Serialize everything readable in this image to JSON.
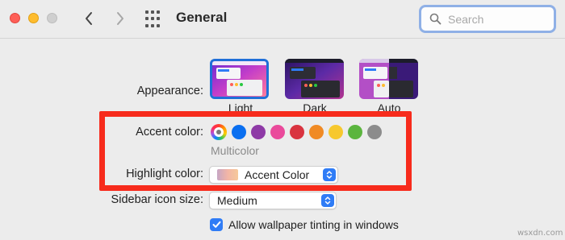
{
  "toolbar": {
    "title": "General",
    "search_placeholder": "Search"
  },
  "appearance": {
    "label": "Appearance:",
    "options": [
      {
        "label": "Light",
        "selected": true
      },
      {
        "label": "Dark",
        "selected": false
      },
      {
        "label": "Auto",
        "selected": false
      }
    ]
  },
  "accent": {
    "label": "Accent color:",
    "selected_name": "Multicolor",
    "colors": [
      "#0a6ff0",
      "#8e3aa6",
      "#ea4a9b",
      "#d9333f",
      "#f08a24",
      "#f7c82e",
      "#5bb53e",
      "#8c8c8c"
    ]
  },
  "highlight": {
    "label": "Highlight color:",
    "value": "Accent Color"
  },
  "sidebar_icon_size": {
    "label": "Sidebar icon size:",
    "value": "Medium"
  },
  "wallpaper_tinting": {
    "label": "Allow wallpaper tinting in windows",
    "checked": true
  },
  "watermark": "wsxdn.com",
  "colors": {
    "accent_blue": "#2f7cf6",
    "annotation_red": "#f72b1c"
  }
}
